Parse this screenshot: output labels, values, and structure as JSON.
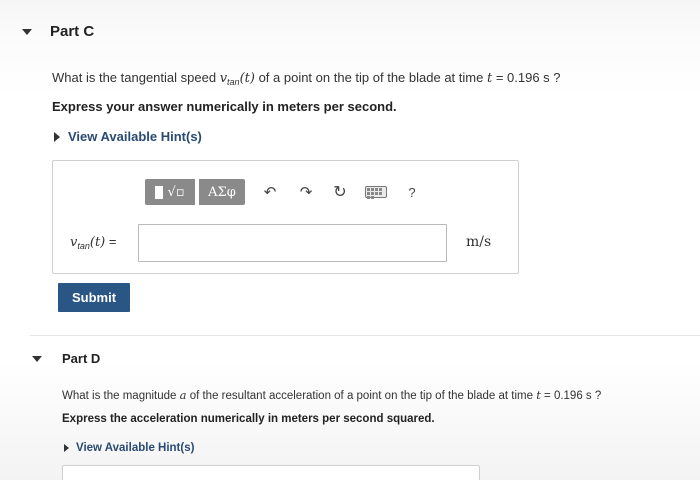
{
  "part_c": {
    "title": "Part C",
    "question_prefix": "What is the tangential speed",
    "var_v": "v",
    "var_sub": "tan",
    "var_arg": "(t)",
    "question_middle": "of a point on the tip of the blade at time",
    "var_t": "t",
    "question_suffix": "= 0.196 s ?",
    "instruction": "Express your answer numerically in meters per second.",
    "hint_label": "View Available Hint(s)",
    "answer_label_suffix": "=",
    "units": "m/s",
    "submit_label": "Submit",
    "input_value": ""
  },
  "toolbar": {
    "greek_label": "ΑΣφ",
    "help_label": "?",
    "icons": [
      "template-icon",
      "sqrt-icon",
      "undo-icon",
      "redo-icon",
      "reset-icon",
      "keyboard-icon",
      "help-icon"
    ]
  },
  "part_d": {
    "title": "Part D",
    "question_prefix": "What is the magnitude",
    "var_a": "a",
    "question_middle": "of the resultant acceleration of a point on the tip of the blade at time",
    "var_t": "t",
    "question_suffix": "= 0.196 s ?",
    "instruction": "Express the acceleration numerically in meters per second squared.",
    "hint_label": "View Available Hint(s)"
  }
}
